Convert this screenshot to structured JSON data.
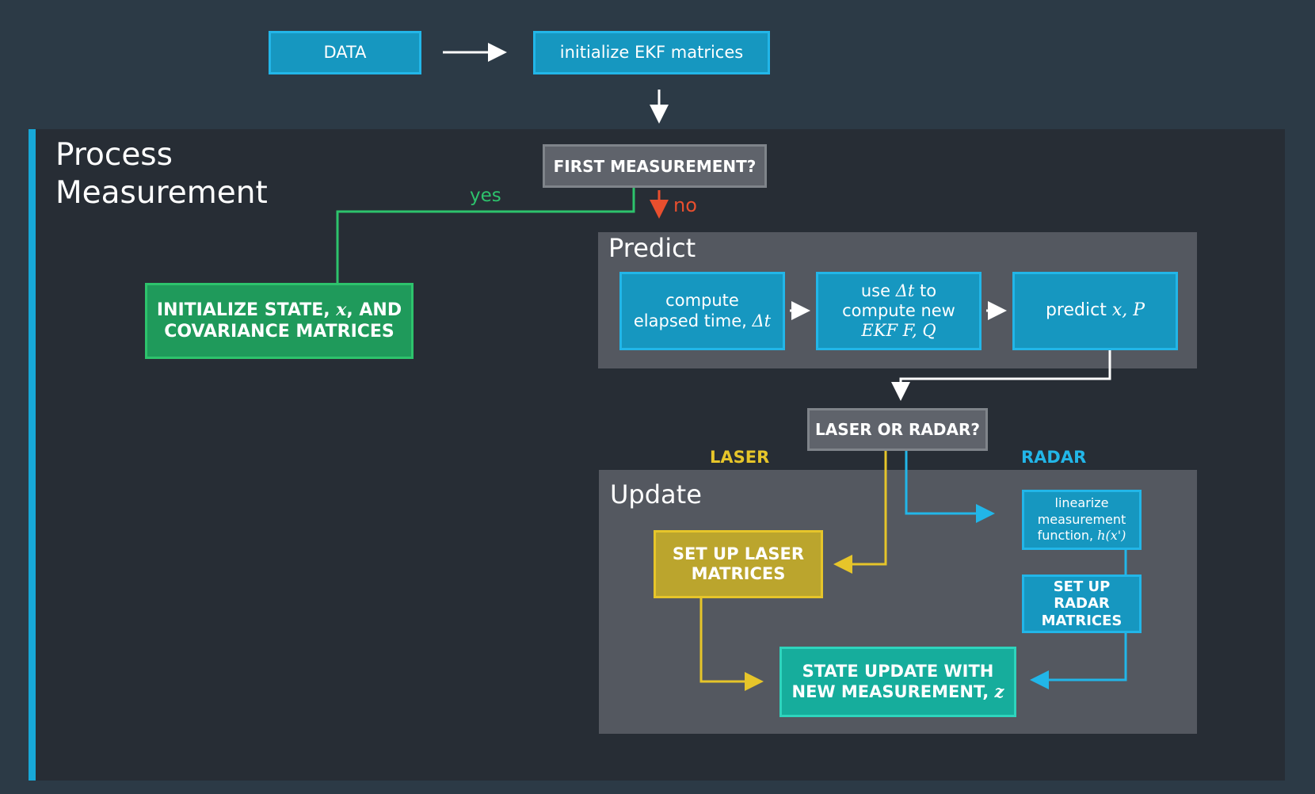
{
  "title": {
    "line1": "Process",
    "line2": "Measurement"
  },
  "colors": {
    "background": "#2c3a46",
    "panel": "#272d35",
    "group": "#545860",
    "accent": "#17a8d8",
    "blue": "#1697c0",
    "green": "#2dc36c",
    "gold": "#e6c52a",
    "teal": "#16ad9c",
    "no": "#e94f2e",
    "radar": "#22b6e8"
  },
  "nodes": {
    "data": "DATA",
    "init_ekf": "initialize EKF matrices",
    "first_measurement": "FIRST MEASUREMENT?",
    "init_state": {
      "line1_a": "INITIALIZE STATE, ",
      "line1_math": "x",
      "line1_b": ", AND",
      "line2": "COVARIANCE MATRICES"
    },
    "compute_dt": {
      "line1": "compute",
      "line2_a": "elapsed time, ",
      "line2_math": "Δt"
    },
    "use_dt": {
      "line1_a": "use ",
      "line1_math": "Δt",
      "line1_b": " to",
      "line2": "compute new",
      "line3_math": "EKF F, Q"
    },
    "predict_xp": {
      "text": "predict ",
      "math": "x, P"
    },
    "laser_or_radar": "LASER OR RADAR?",
    "setup_laser": {
      "line1": "SET UP LASER",
      "line2": "MATRICES"
    },
    "linearize": {
      "line1": "linearize",
      "line2": "measurement",
      "line3_a": "function, ",
      "line3_math": "h(x')"
    },
    "setup_radar": {
      "line1": "SET UP RADAR",
      "line2": "MATRICES"
    },
    "state_update": {
      "line1": "STATE UPDATE WITH",
      "line2_a": "NEW MEASUREMENT, ",
      "line2_math": "z"
    }
  },
  "groups": {
    "predict": "Predict",
    "update": "Update"
  },
  "edge_labels": {
    "yes": "yes",
    "no": "no",
    "laser": "LASER",
    "radar": "RADAR"
  }
}
